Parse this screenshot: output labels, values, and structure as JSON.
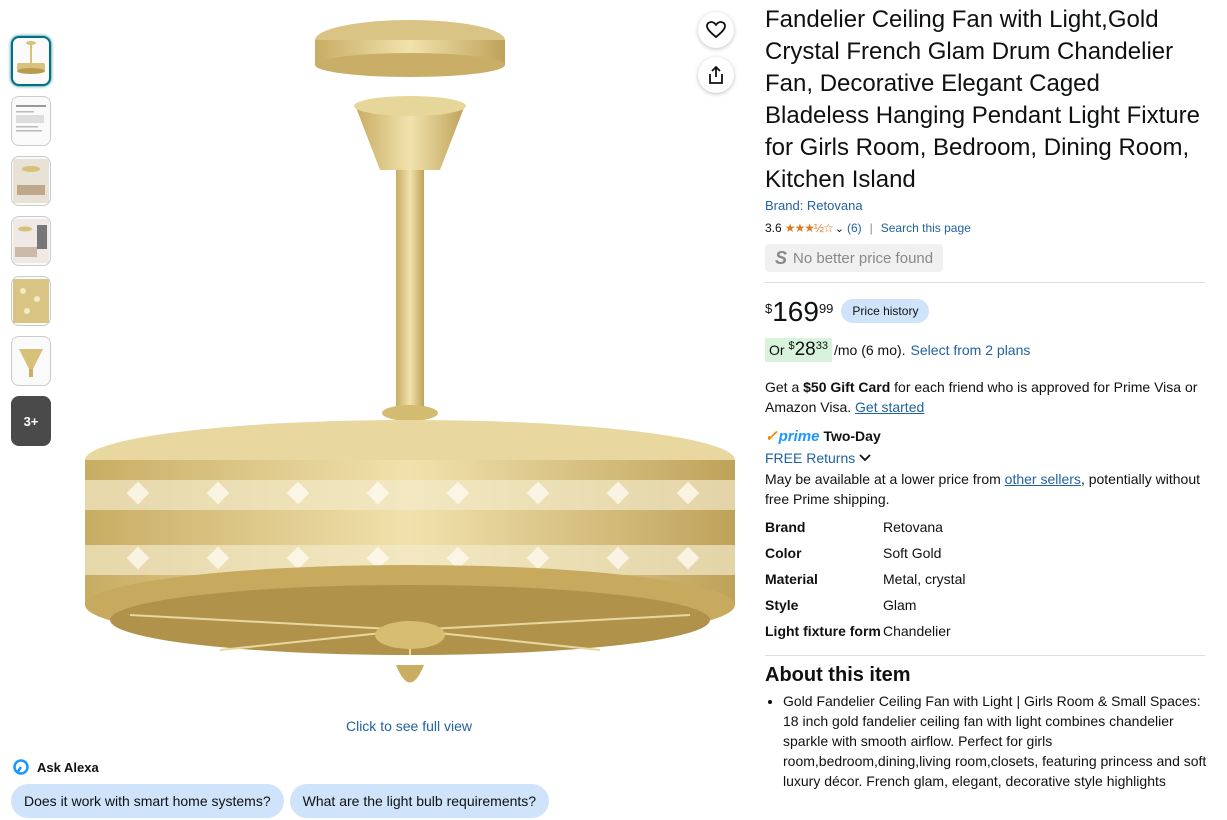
{
  "thumbnails": {
    "more_label": "3+"
  },
  "main_image": {
    "full_view_label": "Click to see full view"
  },
  "alexa": {
    "label": "Ask Alexa",
    "questions": [
      "Does it work with smart home systems?",
      "What are the light bulb requirements?"
    ]
  },
  "product": {
    "title": "Fandelier Ceiling Fan with Light,Gold Crystal French Glam Drum Chandelier Fan, Decorative Elegant Caged Bladeless Hanging Pendant Light Fixture for Girls Room, Bedroom, Dining Room, Kitchen Island",
    "brand_link": "Brand: Retovana",
    "rating": "3.6",
    "rating_stars_value": 3.6,
    "review_count": "(6)",
    "search_page": "Search this page",
    "no_better_price": "No better price found"
  },
  "price": {
    "symbol": "$",
    "whole": "169",
    "fraction": "99",
    "history_label": "Price history",
    "monthly_prefix": "Or ",
    "monthly_symbol": "$",
    "monthly_whole": "28",
    "monthly_fraction": "33",
    "monthly_suffix": "/mo (6 mo).",
    "plans_link": "Select from 2 plans"
  },
  "offers": {
    "gift_prefix": "Get a ",
    "gift_bold": "$50 Gift Card",
    "gift_suffix": " for each friend who is approved for Prime Visa or Amazon Visa. ",
    "gift_link": "Get started",
    "prime_word": "prime",
    "two_day": "Two-Day",
    "free_returns": "FREE Returns",
    "lower_prefix": "May be available at a lower price from ",
    "lower_link": "other sellers",
    "lower_suffix": ", potentially without free Prime shipping."
  },
  "specs": [
    {
      "key": "Brand",
      "value": "Retovana"
    },
    {
      "key": "Color",
      "value": "Soft Gold"
    },
    {
      "key": "Material",
      "value": "Metal, crystal"
    },
    {
      "key": "Style",
      "value": "Glam"
    },
    {
      "key": "Light fixture form",
      "value": "Chandelier"
    }
  ],
  "about": {
    "title": "About this item",
    "bullets": [
      "Gold Fandelier Ceiling Fan with Light | Girls Room & Small Spaces:　 18 inch gold fandelier ceiling fan with light combines chandelier sparkle with smooth airflow. Perfect for girls room,bedroom,dining,living room,closets, featuring princess and soft luxury décor. French glam, elegant, decorative style highlights"
    ]
  },
  "colors": {
    "link": "#2162a1",
    "star": "#de7921",
    "prime": "#1a98ff",
    "chip": "#cfe3fb"
  },
  "icons": {
    "favorite": "heart-icon",
    "share": "share-icon",
    "alexa": "alexa-icon",
    "chevron": "chevron-down-icon"
  }
}
